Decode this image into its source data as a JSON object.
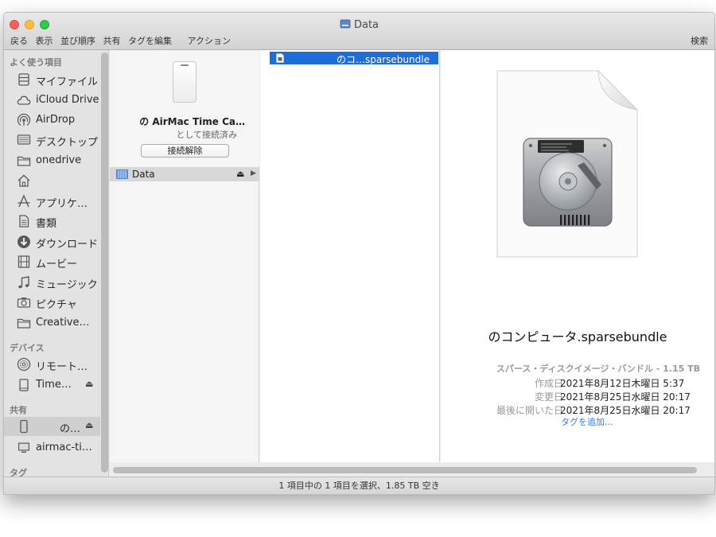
{
  "window": {
    "title": "Data"
  },
  "toolbar": {
    "back": "戻る",
    "view": "表示",
    "arrange": "並び順序",
    "share": "共有",
    "tags": "タグを編集",
    "action": "アクション",
    "search": "検索"
  },
  "sidebar": {
    "favorites_heading": "よく使う項目",
    "favorites": [
      {
        "label": "マイファイル",
        "icon": "all-files-icon"
      },
      {
        "label": "iCloud Drive",
        "icon": "cloud-icon"
      },
      {
        "label": "AirDrop",
        "icon": "airdrop-icon"
      },
      {
        "label": "デスクトップ",
        "icon": "desktop-icon"
      },
      {
        "label": "onedrive",
        "icon": "folder-icon"
      },
      {
        "label": "",
        "icon": "home-icon"
      },
      {
        "label": "アプリケ…",
        "icon": "applications-icon"
      },
      {
        "label": "書類",
        "icon": "document-icon"
      },
      {
        "label": "ダウンロード",
        "icon": "download-icon"
      },
      {
        "label": "ムービー",
        "icon": "movie-icon"
      },
      {
        "label": "ミュージック",
        "icon": "music-icon"
      },
      {
        "label": "ピクチャ",
        "icon": "camera-icon"
      },
      {
        "label": "Creative…",
        "icon": "folder-icon"
      }
    ],
    "devices_heading": "デバイス",
    "devices": [
      {
        "label": "リモート…",
        "icon": "disc-icon"
      },
      {
        "label": "Time…",
        "icon": "drive-icon"
      }
    ],
    "shared_heading": "共有",
    "shared": [
      {
        "label": "の…",
        "icon": "airmac-icon"
      },
      {
        "label": "airmac-ti…",
        "icon": "monitor-icon"
      }
    ],
    "tags_heading": "タグ"
  },
  "column1": {
    "device_name": "の AirMac Time Ca…",
    "device_status": "として接続済み",
    "disconnect_label": "接続解除",
    "volume_label": "Data"
  },
  "column2": {
    "file_label": "のコ…sparsebundle"
  },
  "preview": {
    "filename": "のコンピュータ.sparsebundle",
    "kind": "スパース・ディスクイメージ・バンドル - 1.15 TB",
    "created_label": "作成日",
    "created_value": "2021年8月12日木曜日 5:37",
    "modified_label": "変更日",
    "modified_value": "2021年8月25日水曜日 20:17",
    "opened_label": "最後に開いた日",
    "opened_value": "2021年8月25日水曜日 20:17",
    "add_tags": "タグを追加..."
  },
  "status": {
    "text": "1 項目中の 1 項目を選択、1.85 TB 空き"
  },
  "colors": {
    "selection": "#1d6ed9",
    "link": "#3b7be0"
  }
}
